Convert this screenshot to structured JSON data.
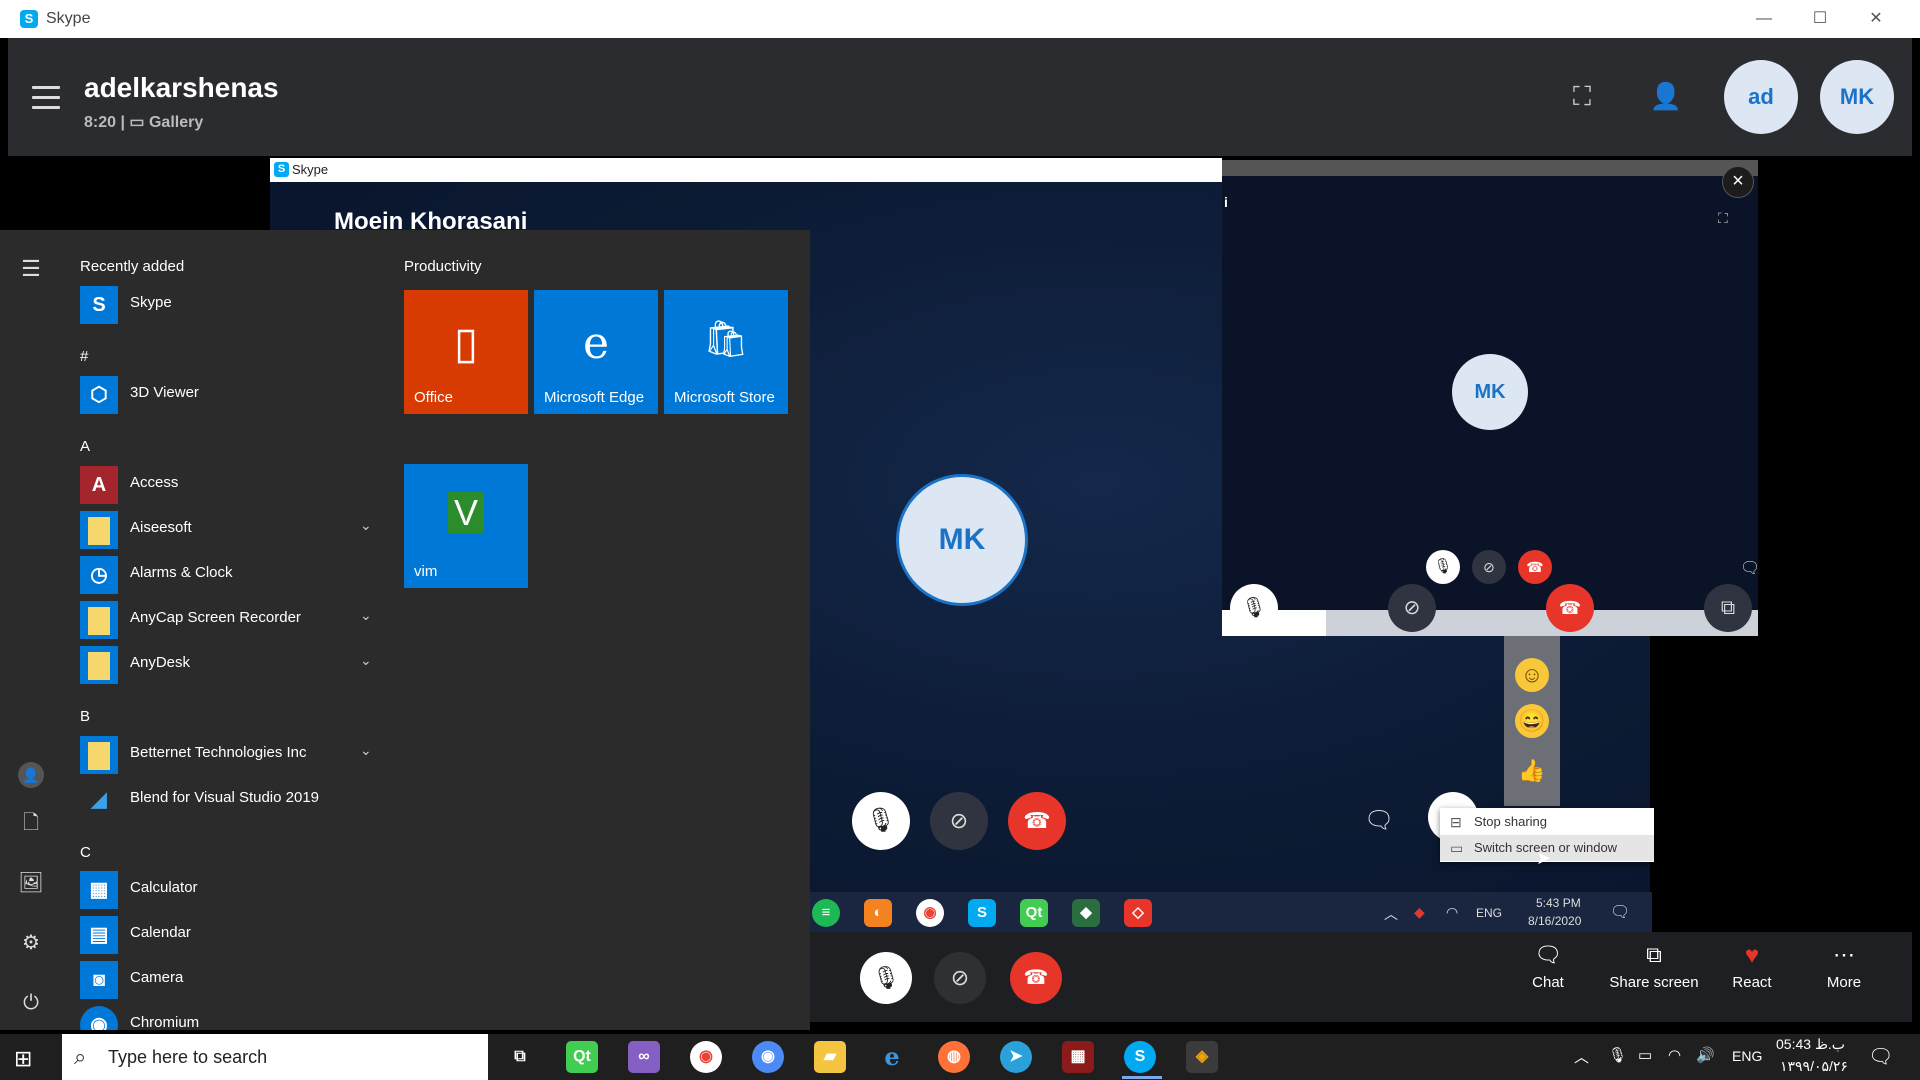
{
  "window": {
    "title": "Skype",
    "minimize": "—",
    "maximize": "☐",
    "close": "✕"
  },
  "call": {
    "name": "adelkarshenas",
    "duration": "8:20",
    "layout": "Gallery",
    "avatar_self": "ad",
    "avatar_peer": "MK"
  },
  "inner_window": {
    "title": "Skype",
    "name": "Moein Khorasani",
    "pip_initials": "MK",
    "main_initials": "MK",
    "pip_char": "i"
  },
  "context_menu": {
    "stop_sharing": "Stop sharing",
    "switch_screen": "Switch screen or window"
  },
  "inner_taskbar": {
    "time": "5:43 PM",
    "date": "8/16/2020",
    "lang": "ENG"
  },
  "call_bar": {
    "chat": "Chat",
    "share_screen": "Share screen",
    "react": "React",
    "more": "More"
  },
  "start_menu": {
    "recently_added_label": "Recently added",
    "productivity_label": "Productivity",
    "recent_app": "Skype",
    "sections": [
      {
        "letter": "#",
        "apps": [
          "3D Viewer"
        ]
      },
      {
        "letter": "A",
        "apps": [
          "Access",
          "Aiseesoft",
          "Alarms & Clock",
          "AnyCap Screen Recorder",
          "AnyDesk"
        ]
      },
      {
        "letter": "B",
        "apps": [
          "Betternet Technologies Inc",
          "Blend for Visual Studio 2019"
        ]
      },
      {
        "letter": "C",
        "apps": [
          "Calculator",
          "Calendar",
          "Camera",
          "Chromium"
        ]
      }
    ],
    "tiles": [
      "Office",
      "Microsoft Edge",
      "Microsoft Store",
      "vim"
    ]
  },
  "taskbar": {
    "search_placeholder": "Type here to search",
    "lang": "ENG",
    "time": "05:43 ب.ظ",
    "date": "۱۳۹۹/۰۵/۲۶"
  },
  "colors": {
    "skype_blue": "#00a9f0",
    "end_call_red": "#e8352a",
    "office_orange": "#d83b01",
    "tile_blue": "#0078d7"
  }
}
